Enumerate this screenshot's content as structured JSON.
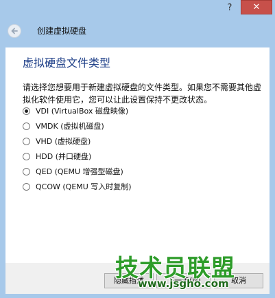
{
  "window": {
    "help_glyph": "?",
    "close_glyph": "✕"
  },
  "header": {
    "back_icon": "arrow-left-icon",
    "title": "创建虚拟硬盘"
  },
  "page": {
    "heading": "虚拟硬盘文件类型",
    "description": "请选择您想要用于新建虚拟硬盘的文件类型。如果您不需要其他虚拟化软件使用它，您可以让此设置保持不更改状态。"
  },
  "options": [
    {
      "label": "VDI (VirtualBox 磁盘映像)",
      "selected": true
    },
    {
      "label": "VMDK (虚拟机磁盘)",
      "selected": false
    },
    {
      "label": "VHD (虚拟硬盘)",
      "selected": false
    },
    {
      "label": "HDD (并口硬盘)",
      "selected": false
    },
    {
      "label": "QED (QEMU 增强型磁盘)",
      "selected": false
    },
    {
      "label": "QCOW (QEMU 写入时复制)",
      "selected": false
    }
  ],
  "footer": {
    "hide_label": "隐藏描述",
    "next_label": "下一步(N)",
    "cancel_label": "取消"
  },
  "watermark": {
    "text": "技术员联盟",
    "url": "www.jsgho.com"
  }
}
